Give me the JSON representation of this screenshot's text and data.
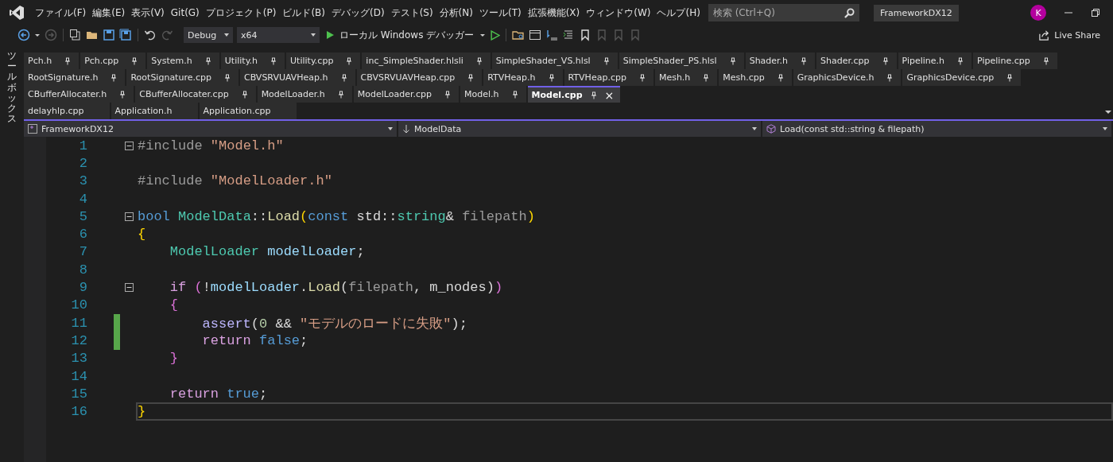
{
  "menu": [
    {
      "label": "ファイル(F)"
    },
    {
      "label": "編集(E)"
    },
    {
      "label": "表示(V)"
    },
    {
      "label": "Git(G)"
    },
    {
      "label": "プロジェクト(P)"
    },
    {
      "label": "ビルド(B)"
    },
    {
      "label": "デバッグ(D)"
    },
    {
      "label": "テスト(S)"
    },
    {
      "label": "分析(N)"
    },
    {
      "label": "ツール(T)"
    },
    {
      "label": "拡張機能(X)"
    },
    {
      "label": "ウィンドウ(W)"
    },
    {
      "label": "ヘルプ(H)"
    }
  ],
  "search": {
    "placeholder": "検索 (Ctrl+Q)"
  },
  "solution_title": "FrameworkDX12",
  "avatar": "K",
  "toolbar": {
    "configuration": "Debug",
    "platform": "x64",
    "run_label": "ローカル Windows デバッガー",
    "live_share": "Live Share"
  },
  "side_panel": "ツールボックス",
  "tab_rows": [
    [
      {
        "label": "Pch.h",
        "selected": false
      },
      {
        "label": "Pch.cpp",
        "selected": false
      },
      {
        "label": "System.h",
        "selected": false
      },
      {
        "label": "Utility.h",
        "selected": false
      },
      {
        "label": "Utility.cpp",
        "selected": false
      },
      {
        "label": "inc_SimpleShader.hlsli",
        "selected": false
      },
      {
        "label": "SimpleShader_VS.hlsl",
        "selected": false
      },
      {
        "label": "SimpleShader_PS.hlsl",
        "selected": false
      },
      {
        "label": "Shader.h",
        "selected": false
      },
      {
        "label": "Shader.cpp",
        "selected": false
      },
      {
        "label": "Pipeline.h",
        "selected": false
      },
      {
        "label": "Pipeline.cpp",
        "selected": false
      }
    ],
    [
      {
        "label": "RootSignature.h",
        "selected": false
      },
      {
        "label": "RootSignature.cpp",
        "selected": false
      },
      {
        "label": "CBVSRVUAVHeap.h",
        "selected": false
      },
      {
        "label": "CBVSRVUAVHeap.cpp",
        "selected": false
      },
      {
        "label": "RTVHeap.h",
        "selected": false
      },
      {
        "label": "RTVHeap.cpp",
        "selected": false
      },
      {
        "label": "Mesh.h",
        "selected": false
      },
      {
        "label": "Mesh.cpp",
        "selected": false
      },
      {
        "label": "GraphicsDevice.h",
        "selected": false
      },
      {
        "label": "GraphicsDevice.cpp",
        "selected": false
      }
    ],
    [
      {
        "label": "CBufferAllocater.h",
        "selected": false
      },
      {
        "label": "CBufferAllocater.cpp",
        "selected": false
      },
      {
        "label": "ModelLoader.h",
        "selected": false
      },
      {
        "label": "ModelLoader.cpp",
        "selected": false
      },
      {
        "label": "Model.h",
        "selected": false
      },
      {
        "label": "Model.cpp",
        "selected": true,
        "close": "×"
      }
    ]
  ],
  "preview_tabs": [
    {
      "label": "delayhlp.cpp"
    },
    {
      "label": "Application.h"
    },
    {
      "label": "Application.cpp"
    }
  ],
  "navigation": {
    "project": "FrameworkDX12",
    "scope": "ModelData",
    "member": "Load(const std::string & filepath)"
  },
  "lines": [
    {
      "number": "1",
      "modified": false,
      "fold": true,
      "current": false,
      "tokens": [
        {
          "kind": "preproc",
          "text": "#include "
        },
        {
          "kind": "string",
          "text": "\"Model.h\""
        }
      ]
    },
    {
      "number": "2",
      "modified": false,
      "fold": false,
      "current": false
    },
    {
      "number": "3",
      "modified": false,
      "fold": false,
      "current": false,
      "tokens": [
        {
          "kind": "preproc",
          "text": "#include "
        },
        {
          "kind": "string",
          "text": "\"ModelLoader.h\""
        }
      ]
    },
    {
      "number": "4",
      "modified": false,
      "fold": false,
      "current": false
    },
    {
      "number": "5",
      "modified": false,
      "fold": true,
      "current": false,
      "tokens": [
        {
          "kind": "keyword",
          "text": "bool "
        },
        {
          "kind": "type",
          "text": "ModelData"
        },
        {
          "kind": "plain",
          "text": "::"
        },
        {
          "kind": "function",
          "text": "Load"
        },
        {
          "kind": "bracket",
          "text": "("
        },
        {
          "kind": "keyword",
          "text": "const"
        },
        {
          "kind": "plain",
          "text": " std::"
        },
        {
          "kind": "type",
          "text": "string"
        },
        {
          "kind": "plain",
          "text": "& "
        },
        {
          "kind": "param",
          "text": "filepath"
        },
        {
          "kind": "bracket",
          "text": ")"
        }
      ]
    },
    {
      "number": "6",
      "modified": false,
      "fold": false,
      "current": false,
      "tokens": [
        {
          "kind": "bracket",
          "text": "{"
        }
      ]
    },
    {
      "number": "7",
      "modified": false,
      "fold": false,
      "current": false,
      "tokens": [
        {
          "kind": "type",
          "text": "    ModelLoader"
        },
        {
          "kind": "variable",
          "text": " modelLoader"
        },
        {
          "kind": "plain",
          "text": ";"
        }
      ]
    },
    {
      "number": "8",
      "modified": false,
      "fold": false,
      "current": false
    },
    {
      "number": "9",
      "modified": false,
      "fold": true,
      "current": false,
      "tokens": [
        {
          "kind": "control",
          "text": "    if "
        },
        {
          "kind": "bracket2",
          "text": "("
        },
        {
          "kind": "plain",
          "text": "!"
        },
        {
          "kind": "variable",
          "text": "modelLoader"
        },
        {
          "kind": "plain",
          "text": "."
        },
        {
          "kind": "function",
          "text": "Load"
        },
        {
          "kind": "plain",
          "text": "("
        },
        {
          "kind": "param",
          "text": "filepath"
        },
        {
          "kind": "plain",
          "text": ", m_nodes)"
        },
        {
          "kind": "bracket2",
          "text": ")"
        }
      ]
    },
    {
      "number": "10",
      "modified": false,
      "fold": false,
      "current": false,
      "tokens": [
        {
          "kind": "bracket2",
          "text": "    {"
        }
      ]
    },
    {
      "number": "11",
      "modified": true,
      "fold": false,
      "current": false,
      "tokens": [
        {
          "kind": "macro",
          "text": "        assert"
        },
        {
          "kind": "plain",
          "text": "("
        },
        {
          "kind": "number",
          "text": "0"
        },
        {
          "kind": "plain",
          "text": " && "
        },
        {
          "kind": "string",
          "text": "\"モデルのロードに失敗\""
        },
        {
          "kind": "plain",
          "text": ");"
        }
      ]
    },
    {
      "number": "12",
      "modified": true,
      "fold": false,
      "current": false,
      "tokens": [
        {
          "kind": "control",
          "text": "        return "
        },
        {
          "kind": "keyword",
          "text": "false"
        },
        {
          "kind": "plain",
          "text": ";"
        }
      ]
    },
    {
      "number": "13",
      "modified": false,
      "fold": false,
      "current": false,
      "tokens": [
        {
          "kind": "bracket2",
          "text": "    }"
        }
      ]
    },
    {
      "number": "14",
      "modified": false,
      "fold": false,
      "current": false
    },
    {
      "number": "15",
      "modified": false,
      "fold": false,
      "current": false,
      "tokens": [
        {
          "kind": "control",
          "text": "    return "
        },
        {
          "kind": "keyword",
          "text": "true"
        },
        {
          "kind": "plain",
          "text": ";"
        }
      ]
    },
    {
      "number": "16",
      "modified": false,
      "fold": false,
      "current": true,
      "tokens": [
        {
          "kind": "bracket",
          "text": "}"
        }
      ]
    }
  ]
}
